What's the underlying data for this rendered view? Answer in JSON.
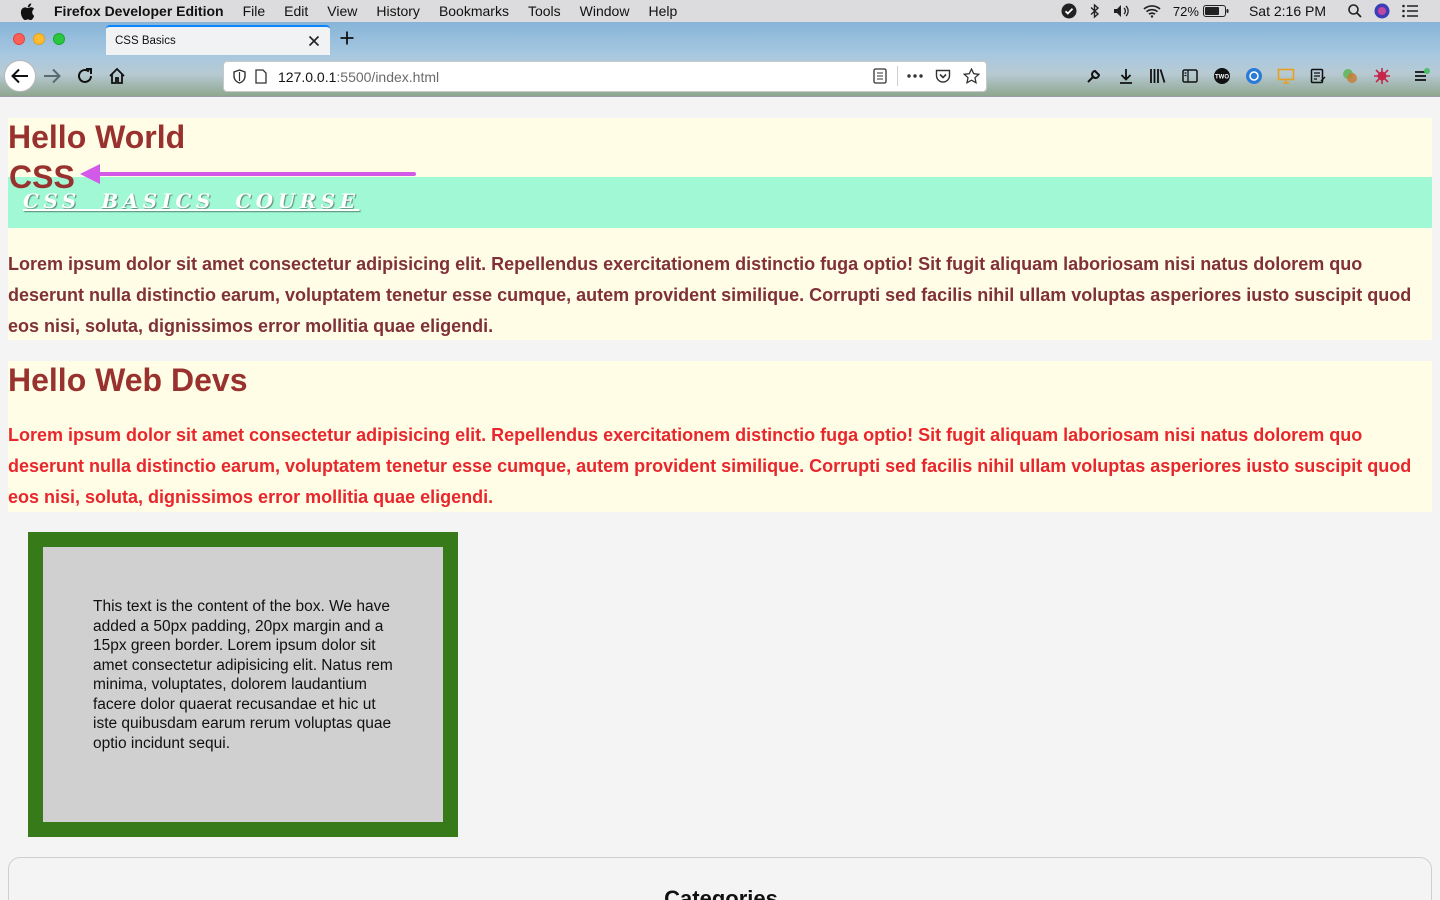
{
  "menubar": {
    "app_name": "Firefox Developer Edition",
    "items": [
      "File",
      "Edit",
      "View",
      "History",
      "Bookmarks",
      "Tools",
      "Window",
      "Help"
    ],
    "battery": "72%",
    "clock": "Sat 2:16 PM"
  },
  "browser": {
    "tab_title": "CSS Basics",
    "url_host": "127.0.0.1",
    "url_rest": ":5500/index.html"
  },
  "page": {
    "heading1": "Hello World",
    "heading2": "CSS",
    "banner": "CSS BASICS COURSE",
    "paragraph1": "Lorem ipsum dolor sit amet consectetur adipisicing elit. Repellendus exercitationem distinctio fuga optio! Sit fugit aliquam laboriosam nisi natus dolorem quo deserunt nulla distinctio earum, voluptatem tenetur esse cumque, autem provident similique. Corrupti sed facilis nihil ullam voluptas asperiores iusto suscipit quod eos nisi, soluta, dignissimos error mollitia quae eligendi.",
    "heading3": "Hello Web Devs",
    "paragraph2": "Lorem ipsum dolor sit amet consectetur adipisicing elit. Repellendus exercitationem distinctio fuga optio! Sit fugit aliquam laboriosam nisi natus dolorem quo deserunt nulla distinctio earum, voluptatem tenetur esse cumque, autem provident similique. Corrupti sed facilis nihil ullam voluptas asperiores iusto suscipit quod eos nisi, soluta, dignissimos error mollitia quae eligendi.",
    "box_text": "This text is the content of the box. We have added a 50px padding, 20px margin and a 15px green border. Lorem ipsum dolor sit amet consectetur adipisicing elit. Natus rem minima, voluptates, dolorem laudantium facere dolor quaerat recusandae et hic ut iste quibusdam earum rerum voluptas quae optio incidunt sequi.",
    "categories_title": "Categories"
  },
  "colors": {
    "heading": "#99322e",
    "paragraph1": "#803038",
    "paragraph2": "#e8262d",
    "banner_bg": "#a0f9d4",
    "section_bg": "#fffde6",
    "box_border": "#377a1a",
    "box_bg": "#d0d0d0",
    "annotation_arrow": "#d35ae8"
  }
}
